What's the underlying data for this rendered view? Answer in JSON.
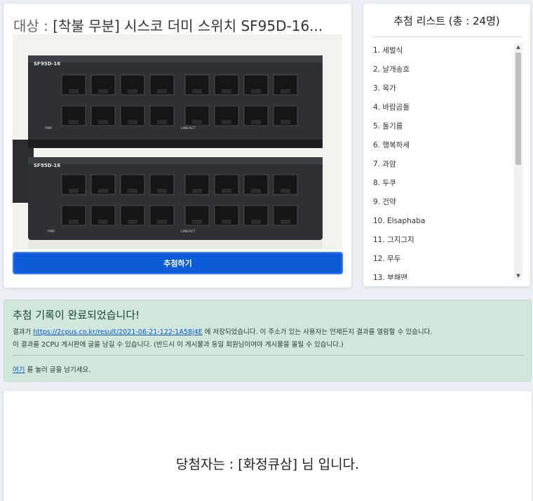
{
  "target": {
    "prefix": "대상 : ",
    "name": "[착불 무분] 시스코 더미 스위치 SF95D-16..."
  },
  "product_image": {
    "model_label": "SF95D-16",
    "pwr_label": "PWR",
    "link_label": "LINK/ACT"
  },
  "draw_button": "추첨하기",
  "draw_list": {
    "title": "추첨 리스트 (총 : 24명)",
    "items": [
      "1. 세벌식",
      "2. 날개송호",
      "3. 옥가",
      "4. 바람곰돌",
      "5. 돌기름",
      "6. 행복하세",
      "7. 과암",
      "8. 두쿠",
      "9. 건약",
      "10. Elsaphaba",
      "11. 그지그지",
      "12. 무두",
      "13. 부해맨"
    ]
  },
  "alert": {
    "heading": "추첨 기록이 완료되었습니다!",
    "line1_pre": "결과가 ",
    "result_url": "https://2cpus.co.kr/result/2021-06-21-122-1A58j4E",
    "line1_post": " 에 저장되었습니다. 이 주소가 있는 사용자는 언제든지 결과를 열람할 수 있습니다.",
    "line2": "이 결과를 2CPU 게시판에 글을 남길 수 있습니다. (반드시 이 게시물과 동일 회원님이여야 게시물을 올릴 수 있습니다.)",
    "here_link": "여기",
    "line3_post": " 를 눌러 글을 남기세요."
  },
  "winner": {
    "text": "당첨자는 : [화정큐삼] 님 입니다."
  }
}
